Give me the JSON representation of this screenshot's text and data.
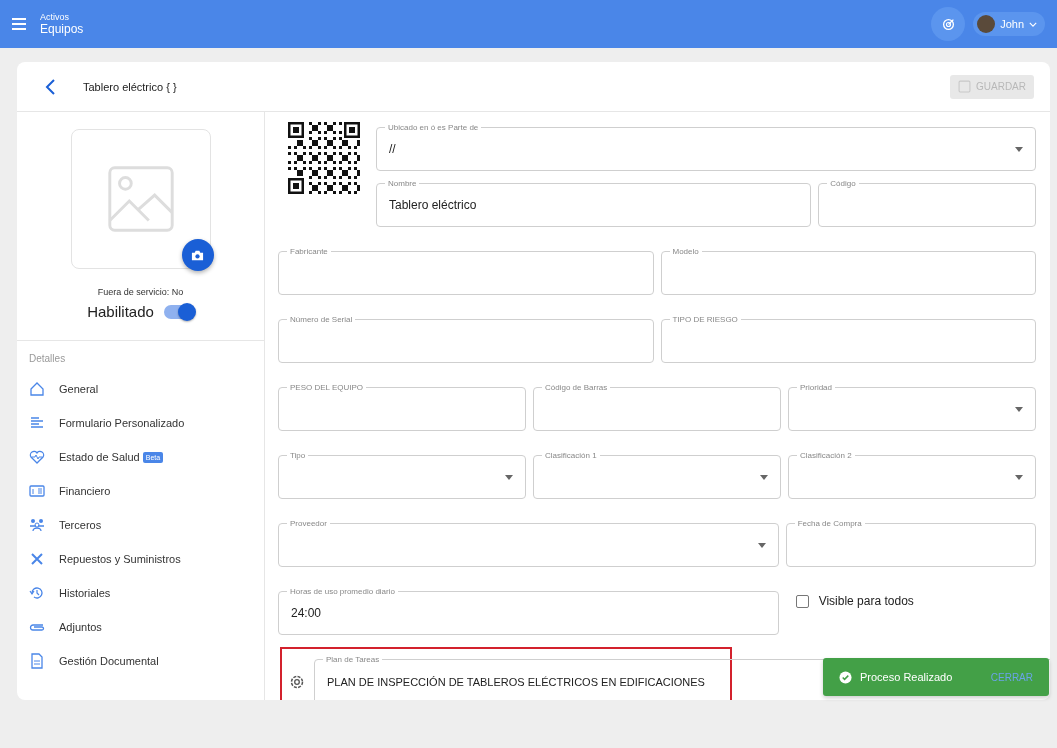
{
  "header": {
    "section": "Activos",
    "title": "Equipos",
    "user": "John"
  },
  "page": {
    "title": "Tablero eléctrico { }",
    "save": {
      "label": "GUARDAR",
      "disabled": true
    }
  },
  "asset": {
    "out_of_service": "Fuera de servicio: No",
    "enabled_label": "Habilitado",
    "enabled": true
  },
  "details": {
    "heading": "Detalles",
    "items": [
      {
        "label": "General"
      },
      {
        "label": "Formulario Personalizado"
      },
      {
        "label": "Estado de Salud",
        "badge": "Beta"
      },
      {
        "label": "Financiero"
      },
      {
        "label": "Terceros"
      },
      {
        "label": "Repuestos y Suministros"
      },
      {
        "label": "Historiales"
      },
      {
        "label": "Adjuntos"
      },
      {
        "label": "Gestión Documental"
      }
    ]
  },
  "top_fields": [
    {
      "kind": "select",
      "label": "Ubicado en ó es Parte de",
      "value": "//"
    },
    {
      "kind": "text",
      "label": "Nombre",
      "value": "Tablero eléctrico"
    },
    {
      "kind": "text",
      "label": "Código"
    }
  ],
  "rows": [
    {
      "kind": "halves",
      "fields": [
        {
          "kind": "text",
          "label": "Fabricante"
        },
        {
          "kind": "text",
          "label": "Modelo"
        }
      ]
    },
    {
      "kind": "halves",
      "fields": [
        {
          "kind": "text",
          "label": "Número de Serial"
        },
        {
          "kind": "text",
          "label": "TIPO DE RIESGO"
        }
      ]
    },
    {
      "kind": "thirds",
      "fields": [
        {
          "kind": "text",
          "label": "PESO DEL EQUIPO"
        },
        {
          "kind": "text",
          "label": "Código de Barras"
        },
        {
          "kind": "select",
          "label": "Prioridad"
        }
      ]
    },
    {
      "kind": "thirds",
      "fields": [
        {
          "kind": "select",
          "label": "Tipo"
        },
        {
          "kind": "select",
          "label": "Clasificación 1"
        },
        {
          "kind": "select",
          "label": "Clasificación 2"
        }
      ]
    },
    {
      "kind": "wide",
      "fields": [
        {
          "kind": "select",
          "label": "Proveedor"
        },
        {
          "kind": "text",
          "label": "Fecha de Compra"
        }
      ]
    },
    {
      "kind": "wide",
      "fields": [
        {
          "kind": "text",
          "label": "Horas de uso promedio diario",
          "value": "24:00"
        },
        {
          "kind": "checkbox",
          "label": "Visible para todos",
          "checked": false
        }
      ]
    }
  ],
  "task_plan": {
    "label": "Plan de Tareas",
    "value": "PLAN DE INSPECCIÓN DE TABLEROS ELÉCTRICOS EN EDIFICACIONES",
    "highlighted": true
  },
  "toast": {
    "message": "Proceso Realizado",
    "action": "CERRAR"
  }
}
